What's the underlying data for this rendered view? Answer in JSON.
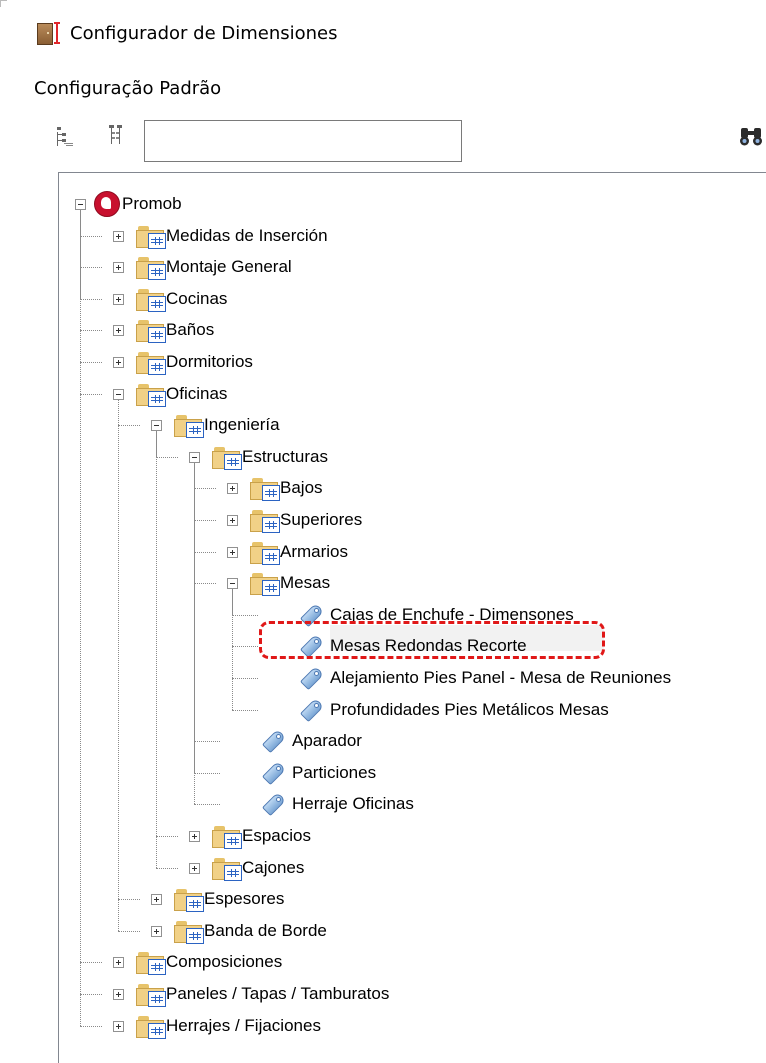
{
  "window": {
    "title": "Configurador de Dimensiones"
  },
  "config": {
    "name": "Configuração Padrão"
  },
  "toolbar": {
    "search_value": "",
    "expand_icon": "expand-tree-icon",
    "collapse_icon": "collapse-tree-icon",
    "search_icon": "binoculars-icon"
  },
  "colors": {
    "highlight": "#e01818",
    "folder": "#f1d187",
    "accent": "#2b63c2"
  },
  "tree": {
    "root": "Promob",
    "items": [
      "Medidas de Inserción",
      "Montaje General",
      "Cocinas",
      "Baños",
      "Dormitorios",
      "Oficinas",
      "Ingeniería",
      "Estructuras",
      "Bajos",
      "Superiores",
      "Armarios",
      "Mesas",
      "Cajas de Enchufe - Dimensones",
      "Mesas Redondas Recorte",
      "Alejamiento Pies Panel - Mesa de Reuniones",
      "Profundidades Pies Metálicos Mesas",
      "Aparador",
      "Particiones",
      "Herraje Oficinas",
      "Espacios",
      "Cajones",
      "Espesores",
      "Banda de Borde",
      "Composiciones",
      "Paneles / Tapas / Tamburatos",
      "Herrajes / Fijaciones"
    ]
  }
}
